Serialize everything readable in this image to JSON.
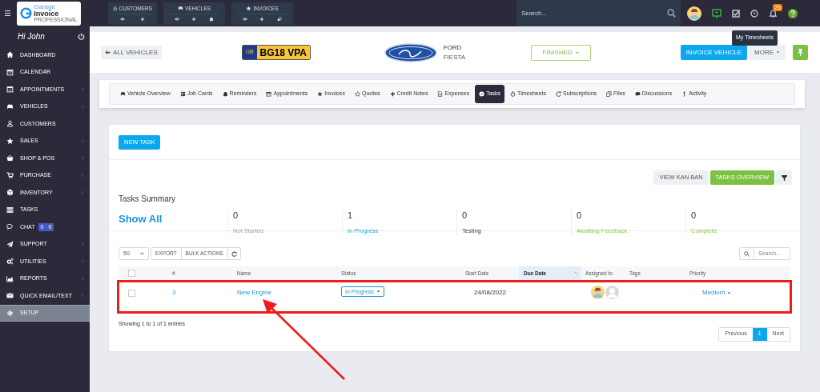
{
  "brand": {
    "line1": "Garage",
    "line2": "Invoice",
    "line3": "PROFESSIONAL"
  },
  "quick_groups": [
    {
      "label": "CUSTOMERS"
    },
    {
      "label": "VEHICLES"
    },
    {
      "label": "INVOICES"
    }
  ],
  "search": {
    "placeholder": "Search..."
  },
  "notifications": {
    "count": "25"
  },
  "tooltip": "My Timesheets",
  "sidebar": {
    "greeting": "Hi John",
    "items": [
      {
        "label": "DASHBOARD",
        "submenu": false,
        "selected": false
      },
      {
        "label": "CALENDAR",
        "submenu": false,
        "selected": false
      },
      {
        "label": "APPOINTMENTS",
        "submenu": true,
        "selected": false
      },
      {
        "label": "VEHICLES",
        "submenu": true,
        "selected": false
      },
      {
        "label": "CUSTOMERS",
        "submenu": false,
        "selected": false
      },
      {
        "label": "SALES",
        "submenu": true,
        "selected": false
      },
      {
        "label": "SHOP & POS",
        "submenu": true,
        "selected": false
      },
      {
        "label": "PURCHASE",
        "submenu": true,
        "selected": false
      },
      {
        "label": "INVENTORY",
        "submenu": true,
        "selected": false
      },
      {
        "label": "TASKS",
        "submenu": false,
        "selected": false
      },
      {
        "label": "CHAT",
        "submenu": false,
        "selected": false,
        "badges": [
          "0",
          "0"
        ]
      },
      {
        "label": "SUPPORT",
        "submenu": true,
        "selected": false
      },
      {
        "label": "UTILITIES",
        "submenu": true,
        "selected": false
      },
      {
        "label": "REPORTS",
        "submenu": true,
        "selected": false
      },
      {
        "label": "QUICK EMAIL/TEXT",
        "submenu": true,
        "selected": false
      },
      {
        "label": "SETUP",
        "submenu": false,
        "selected": true
      }
    ]
  },
  "vehicle": {
    "back": "ALL VEHICLES",
    "plate_country": "GB",
    "plate": "BG18 VPA",
    "make": "FORD",
    "model": "FIESTA",
    "status": "FINISHED",
    "invoice_button": "INVOICE VEHICLE",
    "more_button": "MORE"
  },
  "tabs": [
    {
      "label": "Vehicle Overview",
      "selected": false
    },
    {
      "label": "Job Cards",
      "selected": false
    },
    {
      "label": "Reminders",
      "selected": false
    },
    {
      "label": "Appointments",
      "selected": false
    },
    {
      "label": "Invoices",
      "selected": false
    },
    {
      "label": "Quotes",
      "selected": false
    },
    {
      "label": "Credit Notes",
      "selected": false
    },
    {
      "label": "Expenses",
      "selected": false
    },
    {
      "label": "Tasks",
      "selected": true
    },
    {
      "label": "Timesheets",
      "selected": false
    },
    {
      "label": "Subscriptions",
      "selected": false
    },
    {
      "label": "Files",
      "selected": false
    },
    {
      "label": "Discussions",
      "selected": false
    },
    {
      "label": "Activity",
      "selected": false
    }
  ],
  "tasks": {
    "new_button": "NEW TASK",
    "kanban_button": "VIEW KAN BAN",
    "overview_button": "TASKS OVERVIEW",
    "summary_title": "Tasks Summary",
    "show_all": "Show All",
    "stats": [
      {
        "count": "0",
        "label": "Not Started",
        "kind": "muted"
      },
      {
        "count": "1",
        "label": "In Progress",
        "kind": "info"
      },
      {
        "count": "0",
        "label": "Testing",
        "kind": "plain"
      },
      {
        "count": "0",
        "label": "Awaiting Feedback",
        "kind": "success"
      },
      {
        "count": "0",
        "label": "Complete",
        "kind": "success"
      }
    ],
    "select_all_checked": false,
    "page_size": "50",
    "export_button": "EXPORT",
    "bulk_button": "BULK ACTIONS",
    "search_placeholder": "Search...",
    "columns": [
      {
        "label": "#",
        "sorted": false
      },
      {
        "label": "Name",
        "sorted": false
      },
      {
        "label": "Status",
        "sorted": false
      },
      {
        "label": "Start Date",
        "sorted": false
      },
      {
        "label": "Due Date",
        "sorted": true
      },
      {
        "label": "Assigned to",
        "sorted": false
      },
      {
        "label": "Tags",
        "sorted": false
      },
      {
        "label": "Priority",
        "sorted": false
      }
    ],
    "rows": [
      {
        "checked": false,
        "number": "3",
        "name": "New Engine",
        "status": "In Progress",
        "start_date": "24/08/2022",
        "assignees": [
          {
            "kind": "photo"
          },
          {
            "kind": "placeholder"
          }
        ],
        "priority": "Medium"
      }
    ],
    "info": "Showing 1 to 1 of 1 entries",
    "pagination": [
      {
        "label": "Previous",
        "selected": false
      },
      {
        "label": "1",
        "selected": true
      },
      {
        "label": "Next",
        "selected": false
      }
    ]
  }
}
